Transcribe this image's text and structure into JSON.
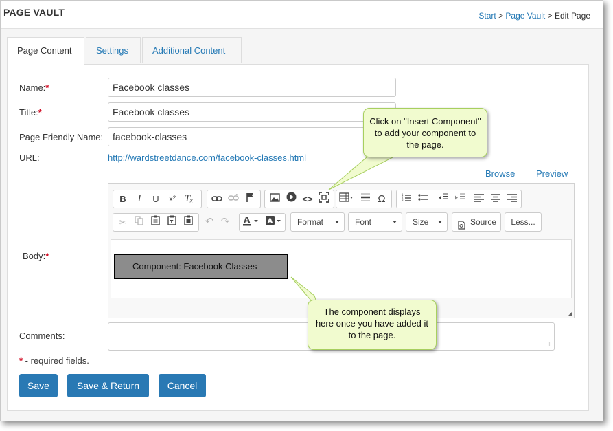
{
  "header": {
    "title": "PAGE VAULT",
    "breadcrumb": {
      "start": "Start",
      "sep": ">",
      "vault": "Page Vault",
      "current": "Edit Page"
    }
  },
  "tabs": [
    {
      "label": "Page Content",
      "active": true
    },
    {
      "label": "Settings",
      "active": false
    },
    {
      "label": "Additional Content",
      "active": false
    }
  ],
  "form": {
    "name_label": "Name:",
    "name_value": "Facebook classes",
    "title_label": "Title:",
    "title_value": "Facebook classes",
    "friendly_label": "Page Friendly Name:",
    "friendly_value": "facebook-classes",
    "url_label": "URL:",
    "url_value": "http://wardstreetdance.com/facebook-classes.html",
    "body_label": "Body:",
    "comments_label": "Comments:",
    "required_asterisk": "*",
    "required_note": " - required fields."
  },
  "editor_links": {
    "browse": "Browse",
    "preview": "Preview"
  },
  "toolbar": {
    "format": "Format",
    "font": "Font",
    "size": "Size",
    "source": "Source",
    "less": "Less..."
  },
  "component_block": "Component: Facebook Classes",
  "buttons": {
    "save": "Save",
    "save_return": "Save & Return",
    "cancel": "Cancel"
  },
  "callouts": {
    "insert": "Click on \"Insert Component\" to add your component to the page.",
    "display": "The component displays here once you have added it to the page."
  },
  "colors": {
    "primary": "#2979b4",
    "link": "#2479b5",
    "required": "#d0021b",
    "callout_bg": "#f1fbcf"
  }
}
